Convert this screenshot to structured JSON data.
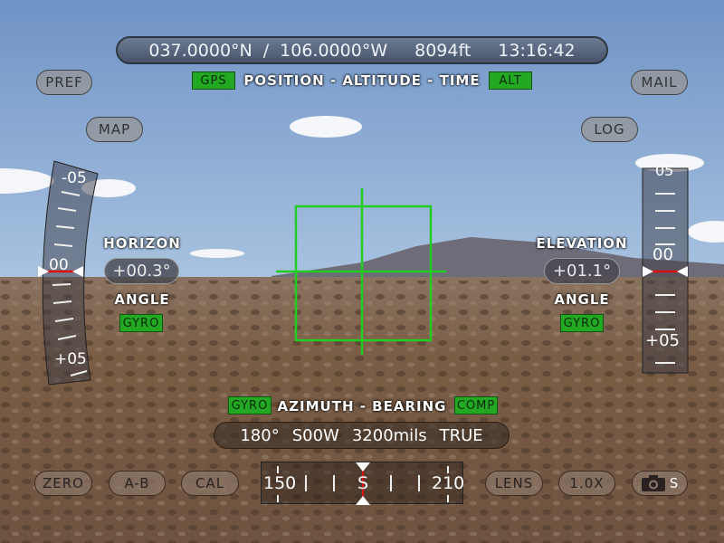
{
  "top": {
    "latitude": "037.0000°N",
    "separator": "/",
    "longitude": "106.0000°W",
    "altitude": "8094ft",
    "time": "13:16:42",
    "gps_badge": "GPS",
    "title": "POSITION - ALTITUDE - TIME",
    "alt_badge": "ALT"
  },
  "buttons": {
    "pref": "PREF",
    "mail": "MAIL",
    "map": "MAP",
    "log": "LOG",
    "zero": "ZERO",
    "ab": "A-B",
    "cal": "CAL",
    "lens": "LENS",
    "zoom": "1.0X",
    "camera_suffix": "S"
  },
  "horizon": {
    "label": "HORIZON",
    "value": "+00.3°",
    "sublabel": "ANGLE",
    "badge": "GYRO",
    "tape_labels": [
      "-05",
      "00",
      "+05"
    ]
  },
  "elevation": {
    "label": "ELEVATION",
    "value": "+01.1°",
    "sublabel": "ANGLE",
    "badge": "GYRO",
    "tape_labels": [
      "05",
      "00",
      "+05"
    ]
  },
  "azimuth": {
    "gyro_badge": "GYRO",
    "title": "AZIMUTH - BEARING",
    "comp_badge": "COMP",
    "degrees": "180°",
    "quadrant": "S00W",
    "mils": "3200mils",
    "reference": "TRUE",
    "compass": {
      "left": "150",
      "center": "S",
      "right": "210"
    }
  },
  "colors": {
    "crosshair": "#22cc22",
    "badge": "#22a822",
    "indicator": "#dd1111"
  }
}
